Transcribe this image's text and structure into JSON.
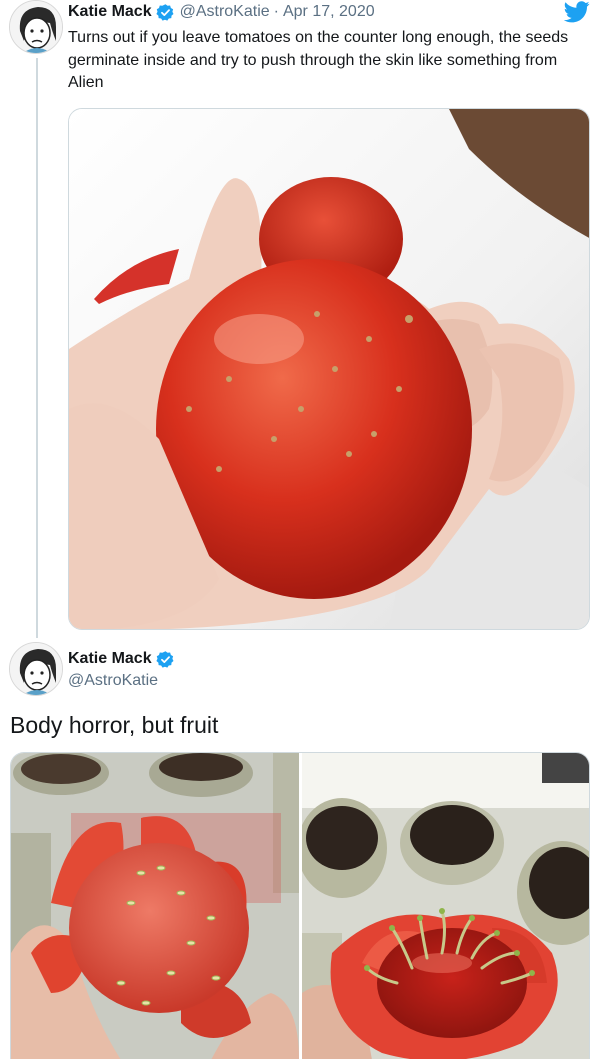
{
  "tweet1": {
    "author_name": "Katie Mack",
    "author_handle": "@AstroKatie",
    "separator": "·",
    "date": "Apr 17, 2020",
    "text": "Turns out if you leave tomatoes on the counter long enough, the seeds germinate inside and try to push through the skin like something from Alien",
    "avatar_icon": "cartoon-avatar-icon",
    "verified_icon": "verified-badge-icon",
    "logo_icon": "twitter-bird-icon"
  },
  "tweet2": {
    "author_name": "Katie Mack",
    "author_handle": "@AstroKatie",
    "text": "Body horror, but fruit",
    "avatar_icon": "cartoon-avatar-icon",
    "verified_icon": "verified-badge-icon"
  },
  "colors": {
    "verified_blue": "#1da1f2",
    "handle_gray": "#5b7083",
    "thread_line": "#cfd9de",
    "tomato_red": "#d92a1c"
  }
}
